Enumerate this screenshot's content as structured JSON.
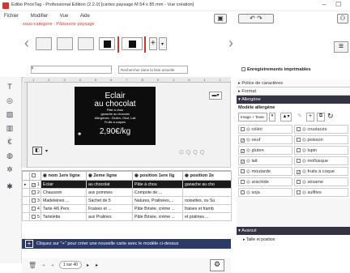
{
  "window": {
    "title": "Editio PriceTag - Professional Edition (2.2.0) [cartes paysage M 54 x 85 mm - Vue création]",
    "minimize": "–",
    "maximize": "☐"
  },
  "menu": [
    "Fichier",
    "Modifier",
    "Vue",
    "Aide"
  ],
  "breadcrumb": {
    "label": "sous-catégorie : Pâtisserie paysage"
  },
  "search": {
    "placeholder": "",
    "scope": "Rechercher dans la liste actuelle"
  },
  "label_preview": {
    "line1": "Eclair",
    "line2": "au chocolat",
    "detail1": "Pâte à chou",
    "detail2": "ganache au chocolat",
    "detail3": "Allergènes : Gluten, Oeuf, Lait",
    "detail4": "Fruits à coques",
    "price": "2,90€/kg"
  },
  "ruler_marks": [
    "1",
    "2",
    "3",
    "4",
    "5",
    "6",
    "7",
    "8",
    "9",
    "10",
    "11"
  ],
  "zoom_controls": [
    "⊡",
    "Q",
    "Q",
    "Q"
  ],
  "table": {
    "columns": [
      "nom 1ere ligne",
      "2eme ligne",
      "position 1ere lig",
      "position 2e"
    ],
    "rows": [
      {
        "num": "1",
        "sel": true,
        "c1": "Eclair",
        "c2": "au chocolat",
        "c3": "Pâte à chou",
        "c4": "ganache au cho"
      },
      {
        "num": "2",
        "sel": false,
        "c1": "Chausson",
        "c2": "aux pommes",
        "c3": "Compote de ...",
        "c4": ""
      },
      {
        "num": "3",
        "sel": false,
        "c1": "Madeleines ...",
        "c2": "Sachet de 5",
        "c3": "Natures, Pralinées,...",
        "c4": "noisettes, ou Su"
      },
      {
        "num": "4",
        "sel": false,
        "c1": "Tarte 4/6 Pers",
        "c2": "Fraises et ...",
        "c3": "Pâte Brisée, crème ...",
        "c4": "fraises et framb"
      },
      {
        "num": "5",
        "sel": false,
        "c1": "Tartelette",
        "c2": "aux Pralines",
        "c3": "Pâte Brisée, crème ...",
        "c4": "et pralines ..."
      }
    ]
  },
  "banner": "Cliquez sur \"+\" pour créer une nouvelle carte avec le modèle ci-dessus",
  "pager": {
    "page": "1 sur 40",
    "prev": "◂",
    "prev2": "◂",
    "next": "▸",
    "next2": "▸"
  },
  "right_panel": {
    "printable_label": "Enregistrements imprimables",
    "sections": [
      "Police de caractères",
      "Format"
    ],
    "allergen_section": "Allergène",
    "allergen_model": "Modèle allergène",
    "image_text": "Image + Texte",
    "allergens": [
      {
        "name": "céléri",
        "checked": false
      },
      {
        "name": "crustacés",
        "checked": false
      },
      {
        "name": "oeuf",
        "checked": true
      },
      {
        "name": "poisson",
        "checked": false
      },
      {
        "name": "gluten",
        "checked": true
      },
      {
        "name": "lupin",
        "checked": false
      },
      {
        "name": "lait",
        "checked": true
      },
      {
        "name": "mollusque",
        "checked": false
      },
      {
        "name": "moutarde",
        "checked": false
      },
      {
        "name": "fruits à coque",
        "checked": true
      },
      {
        "name": "arachide",
        "checked": false
      },
      {
        "name": "sésame",
        "checked": false
      },
      {
        "name": "soja",
        "checked": false
      },
      {
        "name": "sulfites",
        "checked": false
      }
    ],
    "advanced": "Avancé",
    "size_position": "Taille et position"
  },
  "colors": {
    "accent": "#2b3a66",
    "red": "#c33"
  }
}
